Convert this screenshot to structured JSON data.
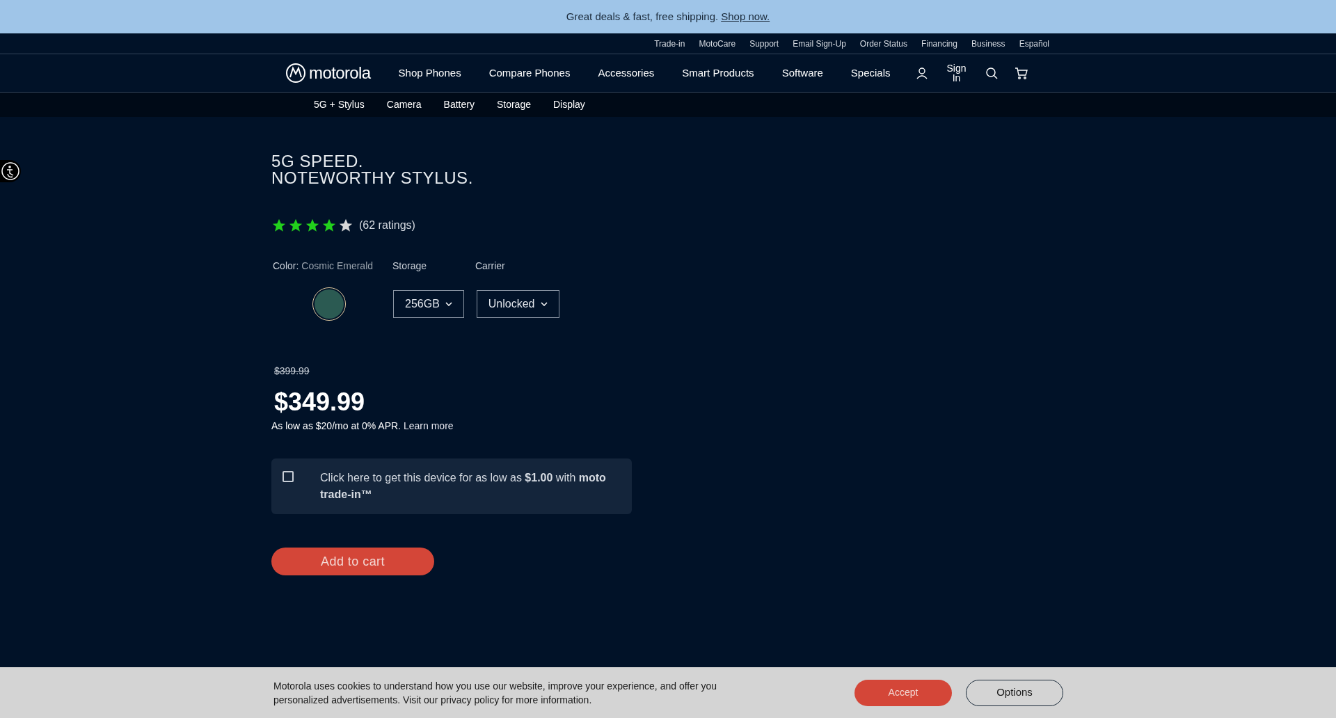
{
  "promo_banner": {
    "text": "Great deals & fast, free shipping.",
    "link": "Shop now."
  },
  "utility_nav": [
    "Trade-in",
    "MotoCare",
    "Support",
    "Email Sign-Up",
    "Order Status",
    "Financing",
    "Business",
    "Español"
  ],
  "main_nav": {
    "logo": "motorola",
    "items": [
      "Shop Phones",
      "Compare Phones",
      "Accessories",
      "Smart Products",
      "Software",
      "Specials"
    ],
    "sign_in": "Sign In"
  },
  "section_nav": [
    "5G + Stylus",
    "Camera",
    "Battery",
    "Storage",
    "Display"
  ],
  "product": {
    "headline": [
      "5G SPEED.",
      "NOTEWORTHY STYLUS."
    ],
    "stars": 4,
    "ratings": "(62 ratings)",
    "color_label": "Color:",
    "color_value": "Cosmic Emerald",
    "storage_label": "Storage",
    "carrier_label": "Carrier",
    "swatches": [
      {
        "color": "#2b5a52",
        "selected": true
      }
    ],
    "storage": "256GB",
    "carrier": "Unlocked",
    "old_price": "$399.99",
    "price": "$349.99",
    "financing": "As low as $20/mo at 0% APR.",
    "financing_link": "Learn more",
    "trade_in": {
      "checked": false,
      "text": "Click here to get this device for as low as **$1.00** with **moto trade-in™**"
    },
    "add_to_cart": "Add to cart"
  },
  "cookie_banner": {
    "text": "Motorola uses cookies to understand how you use our website, improve your experience, and offer you personalized advertisements. Visit our privacy policy for more information.",
    "accept": "Accept",
    "options": "Options"
  }
}
